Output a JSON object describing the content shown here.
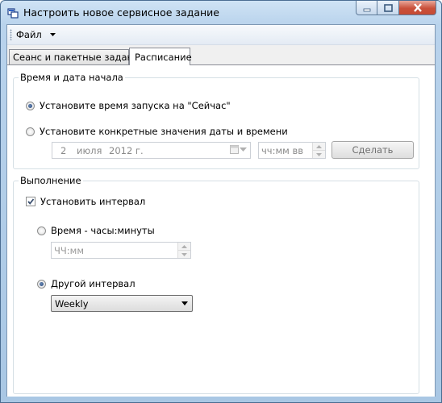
{
  "window": {
    "title": "Настроить новое сервисное задание"
  },
  "menu": {
    "file_label": "Файл"
  },
  "tabs": [
    "Сеанс и пакетные задания",
    "Расписание"
  ],
  "start_group": {
    "title": "Время и дата начала",
    "now_option": "Установите время запуска на \"Сейчас\"",
    "specific_option": "Установите конкретные значения даты и времени",
    "date_day": "2",
    "date_month": "июля",
    "date_year": "2012 г.",
    "time_placeholder": "чч:мм вв",
    "set_button": "Сделать"
  },
  "exec_group": {
    "title": "Выполнение",
    "interval_check": "Установить интервал",
    "hours_option": "Время - часы:минуты",
    "hours_placeholder": "ЧЧ:мм",
    "other_option": "Другой интервал",
    "interval_value": "Weekly"
  },
  "colors": {
    "accent": "#23457a",
    "close_button": "#c9503a",
    "window_frame": "#b9d3ec"
  }
}
